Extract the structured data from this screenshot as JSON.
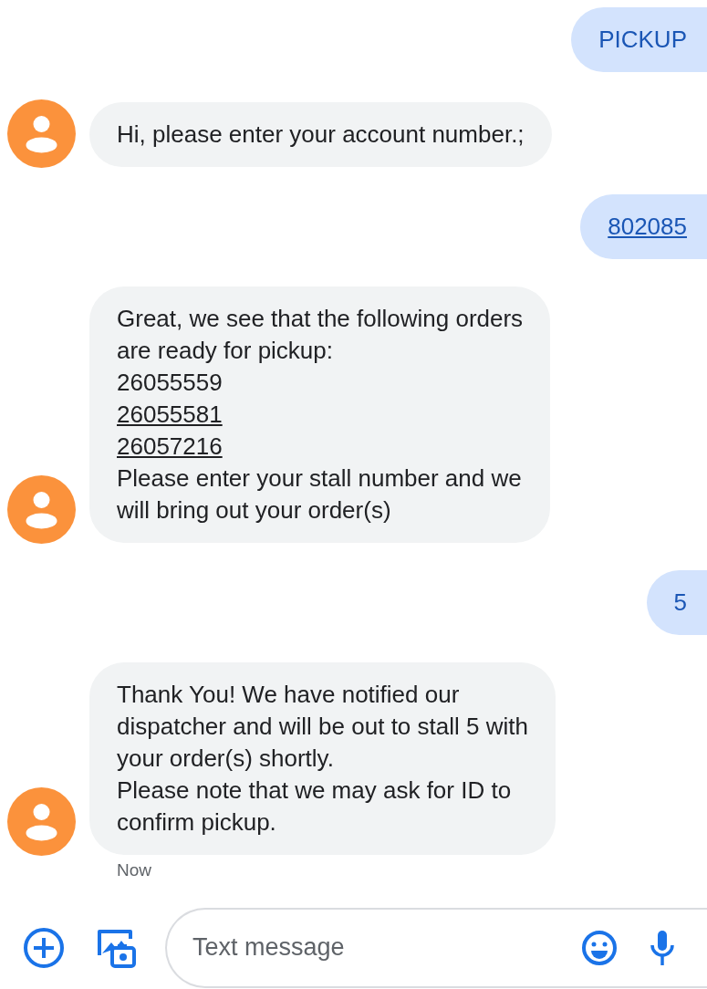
{
  "messages": [
    {
      "kind": "outgoing",
      "lines": [
        {
          "text": "PICKUP",
          "link": false
        }
      ]
    },
    {
      "kind": "incoming",
      "lines": [
        {
          "text": "Hi, please enter your account number.;",
          "link": false
        }
      ]
    },
    {
      "kind": "outgoing",
      "lines": [
        {
          "text": "802085",
          "link": true
        }
      ]
    },
    {
      "kind": "incoming",
      "lines": [
        {
          "text": "Great, we see that the following orders",
          "link": false
        },
        {
          "text": "are ready for pickup:",
          "link": false
        },
        {
          "text": "26055559",
          "link": false
        },
        {
          "text": "26055581",
          "link": true
        },
        {
          "text": "26057216",
          "link": true
        },
        {
          "text": "Please enter your stall number and we",
          "link": false
        },
        {
          "text": "will bring out your order(s)",
          "link": false
        }
      ]
    },
    {
      "kind": "outgoing",
      "lines": [
        {
          "text": "5",
          "link": false
        }
      ]
    },
    {
      "kind": "incoming",
      "lines": [
        {
          "text": "Thank You! We have notified our",
          "link": false
        },
        {
          "text": "dispatcher and will be out to stall 5 with",
          "link": false
        },
        {
          "text": "your order(s) shortly.",
          "link": false
        },
        {
          "text": "Please note that we may ask for ID to",
          "link": false
        },
        {
          "text": "confirm pickup.",
          "link": false
        }
      ]
    }
  ],
  "timestamp": "Now",
  "composer": {
    "placeholder": "Text message"
  }
}
